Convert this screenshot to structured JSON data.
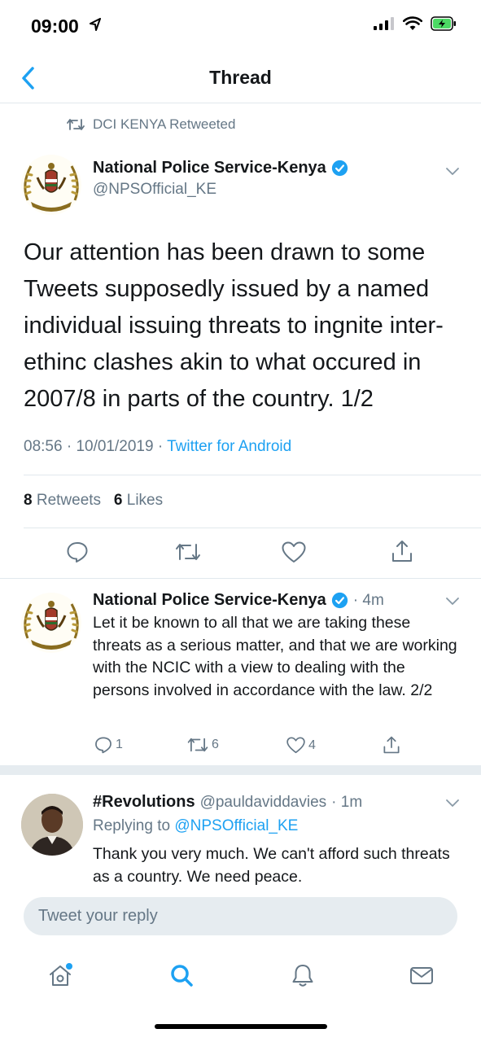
{
  "status_bar": {
    "time": "09:00"
  },
  "nav": {
    "title": "Thread"
  },
  "retweet_note": "DCI KENYA Retweeted",
  "main_tweet": {
    "author_name": "National Police Service-Kenya",
    "handle": "@NPSOfficial_KE",
    "text": "Our attention has been drawn to some Tweets supposedly issued by a named individual issuing threats to ingnite inter-ethinc clashes akin to what occured in 2007/8 in parts of  the country. 1/2",
    "time": "08:56",
    "date": "10/01/2019",
    "source": "Twitter for Android",
    "retweets_count": "8",
    "retweets_label": "Retweets",
    "likes_count": "6",
    "likes_label": "Likes"
  },
  "reply1": {
    "author_name": "National Police Service-Kenya",
    "age": "4m",
    "text": "Let it be known to all that we are taking these threats as a serious matter, and that we are working with the NCIC with a view to dealing with the persons involved in accordance with the law. 2/2",
    "reply_count": "1",
    "retweet_count": "6",
    "like_count": "4"
  },
  "reply2": {
    "author_name": "#Revolutions",
    "handle": "@pauldaviddavies",
    "age": "1m",
    "replying_label": "Replying to",
    "replying_to": "@NPSOfficial_KE",
    "text": "Thank you very much. We can't afford such threats as a country. We need peace."
  },
  "composer": {
    "placeholder": "Tweet your reply"
  },
  "colors": {
    "accent": "#1da1f2",
    "secondary_text": "#657786",
    "primary_text": "#14171a",
    "divider": "#e1e8ed"
  },
  "icons": [
    "back-chevron-icon",
    "retweet-icon",
    "verified-badge-icon",
    "caret-down-icon",
    "reply-icon",
    "like-icon",
    "share-icon",
    "home-icon",
    "search-icon",
    "notifications-icon",
    "messages-icon"
  ]
}
